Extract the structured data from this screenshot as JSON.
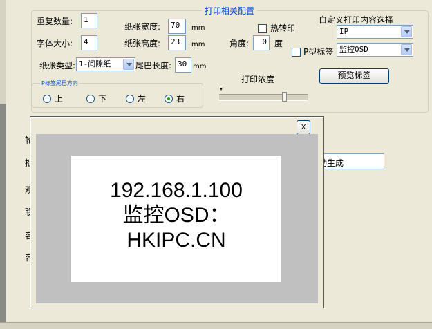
{
  "config": {
    "title": "打印相关配置",
    "repeat_label": "重复数量:",
    "repeat_value": "1",
    "font_size_label": "字体大小:",
    "font_size_value": "4",
    "paper_width_label": "纸张宽度:",
    "paper_width_value": "70",
    "paper_width_unit": "mm",
    "paper_height_label": "纸张高度:",
    "paper_height_value": "23",
    "paper_height_unit": "mm",
    "paper_type_label": "纸张类型:",
    "paper_type_value": "1-间隙纸",
    "tail_length_label": "尾巴长度:",
    "tail_length_value": "30",
    "tail_length_unit": "mm",
    "hot_transfer_label": "热转印",
    "hot_transfer_checked": false,
    "angle_label": "角度:",
    "angle_value": "0",
    "angle_unit": "度",
    "p_label_check": "P型标签",
    "p_label_checked": false,
    "custom_content_label": "自定义打印内容选择",
    "custom_select_1": "IP",
    "custom_select_2": "监控OSD",
    "darkness_label": "打印浓度",
    "darkness_level_percent": 75,
    "preview_button": "预览标签",
    "direction_group_label": "P标签尾巴方向",
    "direction_options": [
      "上",
      "下",
      "左",
      "右"
    ],
    "direction_selected": "右"
  },
  "background": {
    "left_clipped_labels": [
      "轮",
      "拙",
      "观",
      "联",
      "容",
      "容"
    ],
    "field_tail_text": "动生成"
  },
  "preview_window": {
    "close_label": "X",
    "label_lines": [
      "192.168.1.100",
      "监控OSD：",
      "HKIPC.CN"
    ]
  },
  "colors": {
    "window_bg": "#ece9d8",
    "group_title": "#0046d5",
    "preview_backdrop": "#c0c0c0",
    "label_bg": "#ffffff"
  }
}
